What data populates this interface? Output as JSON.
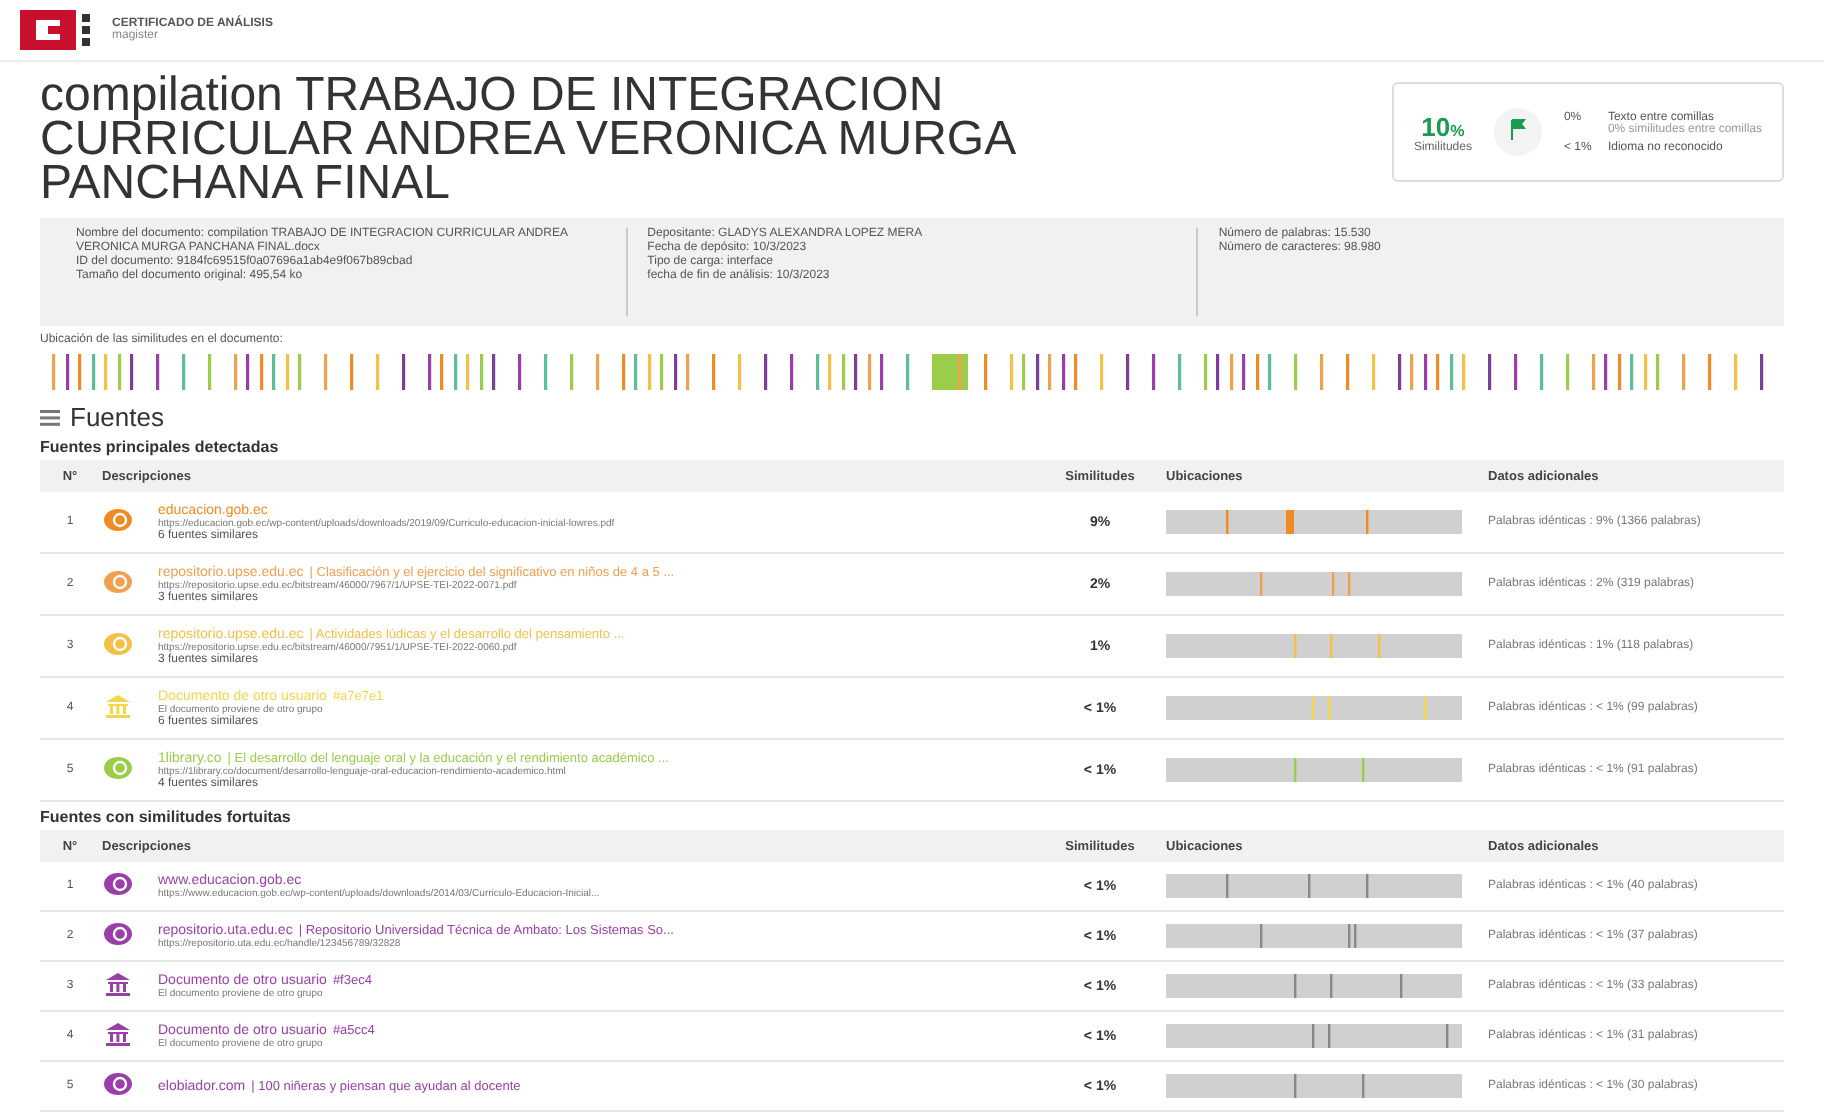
{
  "header": {
    "title": "CERTIFICADO DE ANÁLISIS",
    "subtitle": "magister"
  },
  "document_title": "compilation TRABAJO DE INTEGRACION CURRICULAR ANDREA VERONICA MURGA PANCHANA FINAL",
  "score": {
    "percent": "10",
    "unit": "%",
    "label": "Similitudes",
    "items": [
      {
        "value": "0%",
        "label": "Texto entre comillas",
        "note": "0% similitudes entre comillas"
      },
      {
        "value": "< 1%",
        "label": "Idioma no reconocido"
      }
    ]
  },
  "info": [
    [
      {
        "label": "Nombre del documento:",
        "value": "compilation TRABAJO DE INTEGRACION CURRICULAR ANDREA VERONICA MURGA PANCHANA FINAL.docx"
      },
      {
        "label": "ID del documento:",
        "value": "9184fc69515f0a07696a1ab4e9f067b89cbad"
      },
      {
        "label": "Tamaño del documento original:",
        "value": "495,54 ko"
      }
    ],
    [
      {
        "label": "Depositante:",
        "value": "GLADYS ALEXANDRA LOPEZ MERA"
      },
      {
        "label": "Fecha de depósito:",
        "value": "10/3/2023"
      },
      {
        "label": "Tipo de carga:",
        "value": "interface"
      },
      {
        "label": "fecha de fin de análisis:",
        "value": "10/3/2023"
      }
    ],
    [
      {
        "label": "Número de palabras:",
        "value": "15.530"
      },
      {
        "label": "Número de caracteres:",
        "value": "98.980"
      }
    ]
  ],
  "similarity_map": {
    "label": "Ubicación de las similitudes en el documento:"
  },
  "sources_heading": "Fuentes",
  "tables": [
    {
      "title": "Fuentes principales detectadas",
      "columns": [
        "N°",
        "Descripciones",
        "Similitudes",
        "Ubicaciones",
        "Datos adicionales"
      ],
      "rows": [
        {
          "number": "1",
          "kind": "web",
          "color": "#f08a24",
          "name": "educacion.gob.ec",
          "detail": "",
          "url": "https://educacion.gob.ec/wp-content/uploads/downloads/2019/09/Curriculo-educacion-inicial-lowres.pdf",
          "note": "6 fuentes similares",
          "similarity": "9%",
          "extra": "Palabras idénticas : 9% (1366 palabras)"
        },
        {
          "number": "2",
          "kind": "web",
          "color": "#f0a050",
          "name": "repositorio.upse.edu.ec",
          "detail": "| Clasificación y el ejercicio del significativo en niños de 4 a 5 ...",
          "url": "https://repositorio.upse.edu.ec/bitstream/46000/7967/1/UPSE-TEI-2022-0071.pdf",
          "note": "3 fuentes similares",
          "similarity": "2%",
          "extra": "Palabras idénticas : 2% (319 palabras)"
        },
        {
          "number": "3",
          "kind": "web",
          "color": "#f5c04a",
          "name": "repositorio.upse.edu.ec",
          "detail": "| Actividades lúdicas y el desarrollo del pensamiento ...",
          "url": "https://repositorio.upse.edu.ec/bitstream/46000/7951/1/UPSE-TEI-2022-0060.pdf",
          "note": "3 fuentes similares",
          "similarity": "1%",
          "extra": "Palabras idénticas : 1% (118 palabras)"
        },
        {
          "number": "4",
          "kind": "user-doc",
          "color": "#f2d64b",
          "name": "Documento de otro usuario",
          "detail": "#a7e7e1",
          "url": "El documento proviene de otro grupo",
          "note": "6 fuentes similares",
          "similarity": "< 1%",
          "extra": "Palabras idénticas : < 1% (99 palabras)"
        },
        {
          "number": "5",
          "kind": "web",
          "color": "#9acd4a",
          "name": "1library.co",
          "detail": "| El desarrollo del lenguaje oral y la educación y el rendimiento académico ...",
          "url": "https://1library.co/document/desarrollo-lenguaje-oral-educacion-rendimiento-academico.html",
          "note": "4 fuentes similares",
          "similarity": "< 1%",
          "extra": "Palabras idénticas : < 1% (91 palabras)"
        }
      ]
    },
    {
      "title": "Fuentes con similitudes fortuitas",
      "columns": [
        "N°",
        "Descripciones",
        "Similitudes",
        "Ubicaciones",
        "Datos adicionales"
      ],
      "rows": [
        {
          "number": "1",
          "kind": "web",
          "color": "#9b3fa8",
          "name": "www.educacion.gob.ec",
          "detail": "",
          "url": "https://www.educacion.gob.ec/wp-content/uploads/downloads/2014/03/Curriculo-Educacion-Inicial...",
          "note": "",
          "similarity": "< 1%",
          "extra": "Palabras idénticas : < 1% (40 palabras)"
        },
        {
          "number": "2",
          "kind": "web",
          "color": "#9b3fa8",
          "name": "repositorio.uta.edu.ec",
          "detail": "| Repositorio Universidad Técnica de Ambato: Los Sistemas So...",
          "url": "https://repositorio.uta.edu.ec/handle/123456789/32828",
          "note": "",
          "similarity": "< 1%",
          "extra": "Palabras idénticas : < 1% (37 palabras)"
        },
        {
          "number": "3",
          "kind": "user-doc",
          "color": "#9b3fa8",
          "name": "Documento de otro usuario",
          "detail": "#f3ec4",
          "url": "El documento proviene de otro grupo",
          "note": "",
          "similarity": "< 1%",
          "extra": "Palabras idénticas : < 1% (33 palabras)"
        },
        {
          "number": "4",
          "kind": "user-doc",
          "color": "#9b3fa8",
          "name": "Documento de otro usuario",
          "detail": "#a5cc4",
          "url": "El documento proviene de otro grupo",
          "note": "",
          "similarity": "< 1%",
          "extra": "Palabras idénticas : < 1% (31 palabras)"
        },
        {
          "number": "5",
          "kind": "web",
          "color": "#9b3fa8",
          "name": "elobiador.com",
          "detail": "| 100 niñeras y piensan que ayudan al docente",
          "url": "",
          "note": "",
          "similarity": "< 1%",
          "extra": "Palabras idénticas : < 1% (30 palabras)"
        }
      ]
    }
  ]
}
